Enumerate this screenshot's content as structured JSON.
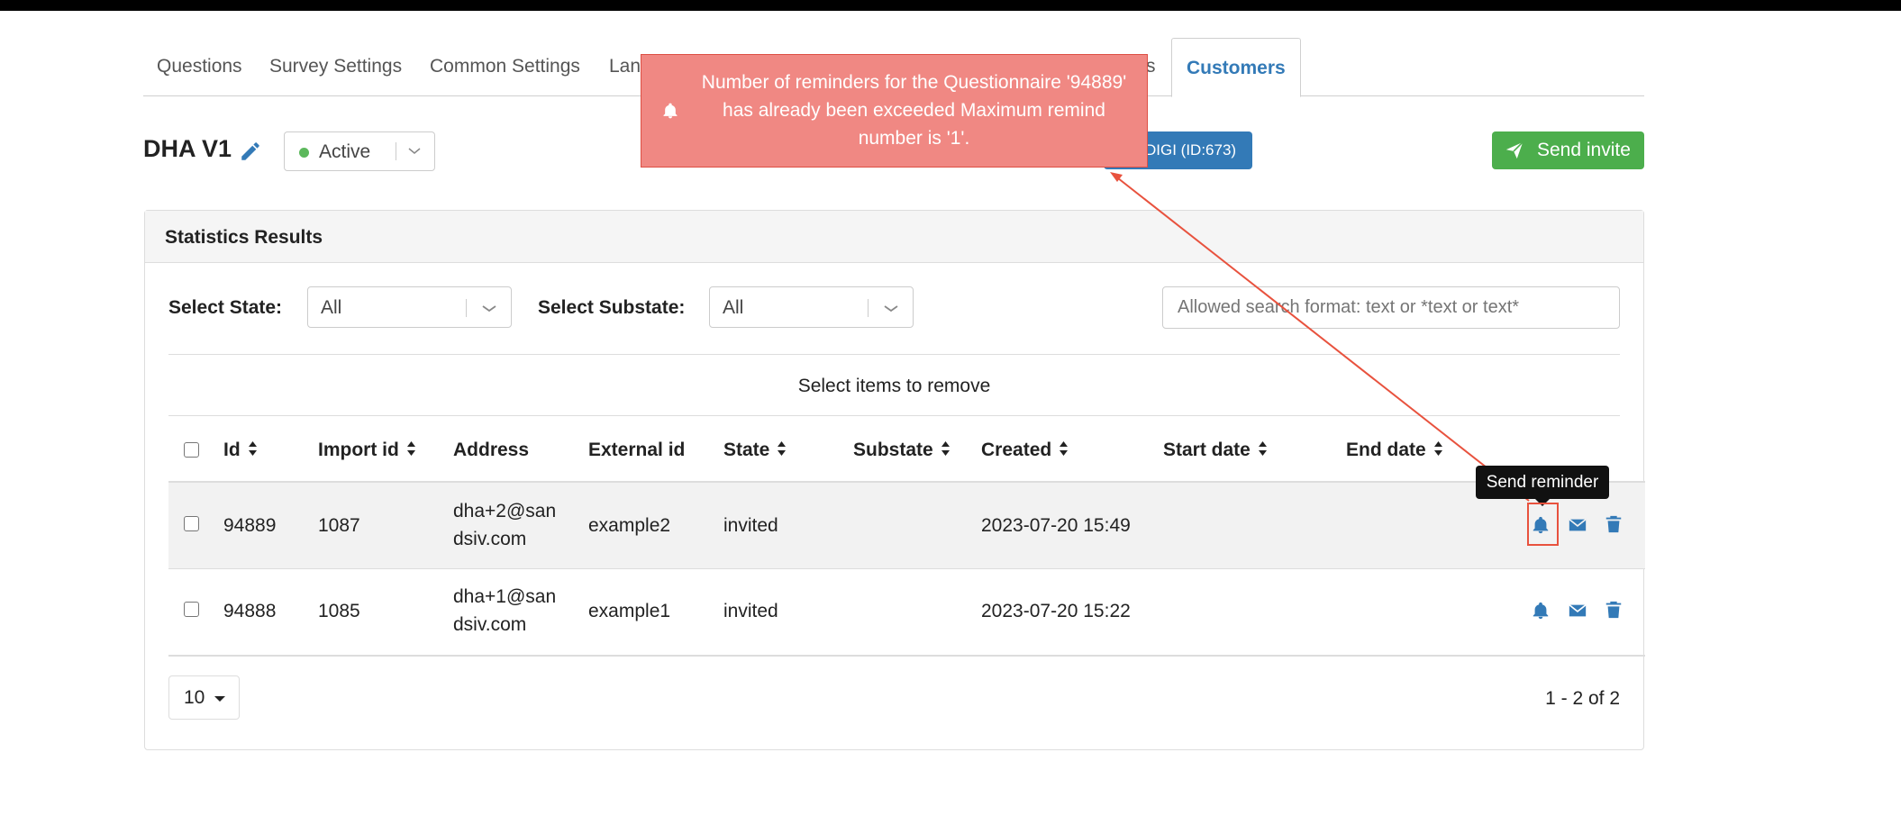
{
  "tabs": [
    {
      "label": "Questions"
    },
    {
      "label": "Survey Settings"
    },
    {
      "label": "Common Settings"
    },
    {
      "label": "Lan"
    },
    {
      "label": "s"
    },
    {
      "label": "Customers"
    }
  ],
  "survey": {
    "title": "DHA V1",
    "status": "Active",
    "campaign_button": "DIGI (ID:673)",
    "send_invite": "Send invite"
  },
  "panel": {
    "title": "Statistics Results",
    "filters": {
      "state_label": "Select State:",
      "state_value": "All",
      "substate_label": "Select Substate:",
      "substate_value": "All",
      "search_placeholder": "Allowed search format: text or *text or text*"
    },
    "remove_label": "Select items to remove",
    "columns": [
      "Id",
      "Import id",
      "Address",
      "External id",
      "State",
      "Substate",
      "Created",
      "Start date",
      "End date"
    ],
    "rows": [
      {
        "id": "94889",
        "import_id": "1087",
        "address_line1": "dha+2@san",
        "address_line2": "dsiv.com",
        "external_id": "example2",
        "state": "invited",
        "substate": "",
        "created": "2023-07-20 15:49",
        "start_date": "",
        "end_date": ""
      },
      {
        "id": "94888",
        "import_id": "1085",
        "address_line1": "dha+1@san",
        "address_line2": "dsiv.com",
        "external_id": "example1",
        "state": "invited",
        "substate": "",
        "created": "2023-07-20 15:22",
        "start_date": "",
        "end_date": ""
      }
    ],
    "page_size": "10",
    "page_info": "1 - 2 of 2"
  },
  "tooltip": "Send reminder",
  "notification": {
    "message": "Number of reminders for the Questionnaire '94889' has already been exceeded Maximum remind number is '1'."
  },
  "colors": {
    "primary": "#337ab7",
    "success": "#4cae4c",
    "notice": "#f08883",
    "annotation": "#e8523e"
  },
  "icons": [
    "edit-icon",
    "status-dot",
    "chevron-down-icon",
    "send-icon",
    "bell-icon",
    "envelope-icon",
    "trash-icon",
    "sort-icon"
  ]
}
